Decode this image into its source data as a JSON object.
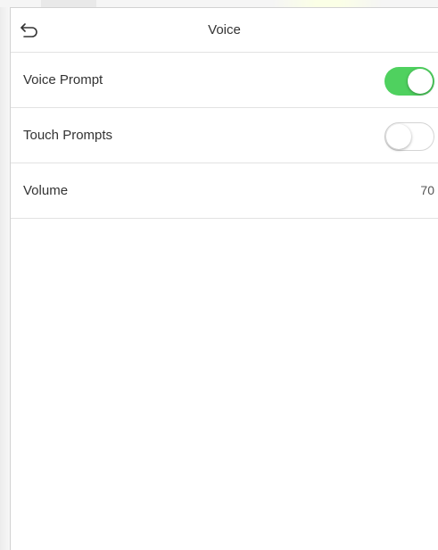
{
  "header": {
    "title": "Voice",
    "back_icon": "back-arrow-icon"
  },
  "settings": [
    {
      "label": "Voice Prompt",
      "type": "toggle",
      "enabled": true
    },
    {
      "label": "Touch Prompts",
      "type": "toggle",
      "enabled": false
    },
    {
      "label": "Volume",
      "type": "value",
      "value": "70"
    }
  ],
  "colors": {
    "toggle_on": "#4fd15f",
    "divider": "#e2e2e2",
    "text": "#333333"
  }
}
